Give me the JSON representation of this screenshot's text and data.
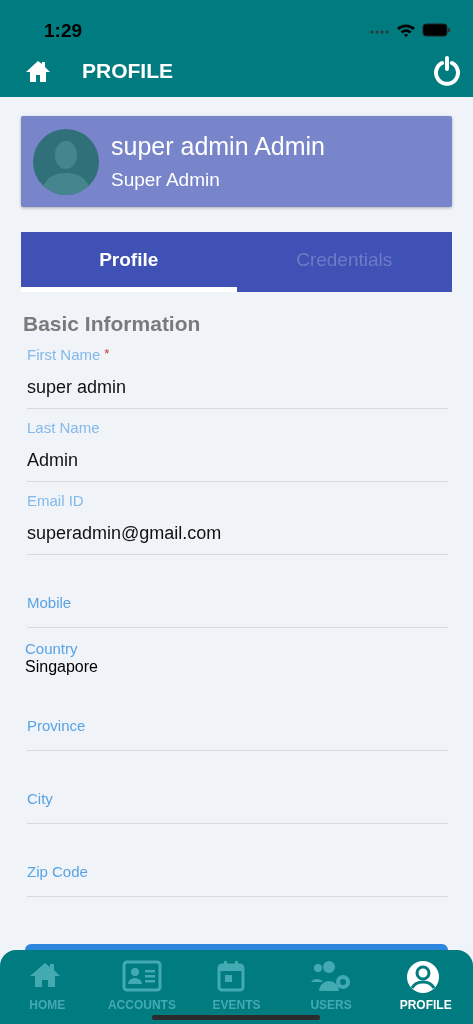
{
  "status_bar": {
    "time": "1:29"
  },
  "header": {
    "title": "PROFILE"
  },
  "profile_card": {
    "name": "super admin Admin",
    "role": "Super Admin"
  },
  "tabs": [
    {
      "label": "Profile",
      "selected": true
    },
    {
      "label": "Credentials",
      "selected": false
    }
  ],
  "section_title": "Basic Information",
  "fields": [
    {
      "kind": "text",
      "label": "First Name",
      "required_mark": "*",
      "value": "super admin"
    },
    {
      "kind": "text",
      "label": "Last Name",
      "value": "Admin"
    },
    {
      "kind": "text",
      "label": "Email ID",
      "value": "superadmin@gmail.com"
    },
    {
      "kind": "empty",
      "placeholder": "Mobile"
    },
    {
      "kind": "select",
      "label": "Country",
      "value": "Singapore"
    },
    {
      "kind": "empty",
      "placeholder": "Province"
    },
    {
      "kind": "empty",
      "placeholder": "City"
    },
    {
      "kind": "empty",
      "placeholder": "Zip Code"
    }
  ],
  "bottom_nav": [
    {
      "label": "HOME",
      "kind": "home",
      "selected": false
    },
    {
      "label": "ACCOUNTS",
      "kind": "card",
      "selected": false
    },
    {
      "label": "EVENTS",
      "kind": "calendar",
      "selected": false
    },
    {
      "label": "USERS",
      "kind": "users",
      "selected": false
    },
    {
      "label": "PROFILE",
      "kind": "person",
      "selected": true
    }
  ]
}
